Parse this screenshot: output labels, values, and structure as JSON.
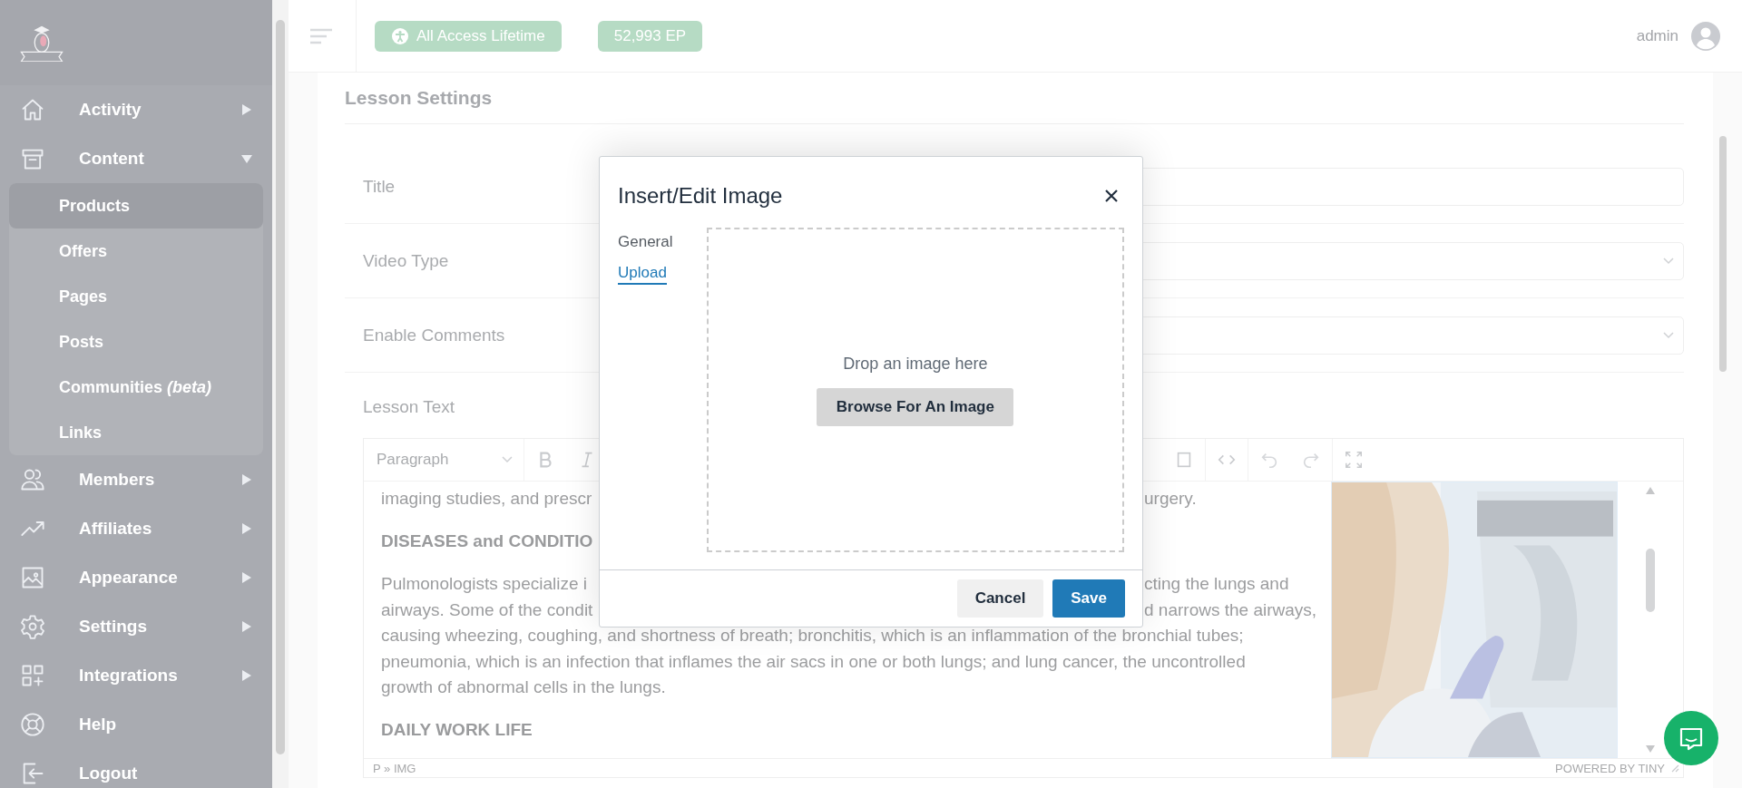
{
  "sidebar": {
    "items": [
      {
        "label": "Activity",
        "expanded": false
      },
      {
        "label": "Content",
        "expanded": true,
        "children": [
          {
            "label": "Products",
            "selected": true
          },
          {
            "label": "Offers",
            "selected": false
          },
          {
            "label": "Pages",
            "selected": false
          },
          {
            "label": "Posts",
            "selected": false
          },
          {
            "label": "Communities *(beta)*",
            "selected": false
          },
          {
            "label": "Links",
            "selected": false
          }
        ]
      },
      {
        "label": "Members",
        "expanded": false
      },
      {
        "label": "Affiliates",
        "expanded": false
      },
      {
        "label": "Appearance",
        "expanded": false
      },
      {
        "label": "Settings",
        "expanded": false
      },
      {
        "label": "Integrations",
        "expanded": false
      },
      {
        "label": "Help"
      },
      {
        "label": "Logout"
      }
    ]
  },
  "topbar": {
    "badges": [
      "All Access Lifetime",
      "52,993 EP"
    ],
    "user": "admin"
  },
  "form": {
    "title": "Lesson Settings",
    "fields": [
      {
        "label": "Title",
        "kind": "input"
      },
      {
        "label": "Video Type",
        "kind": "select"
      },
      {
        "label": "Enable Comments",
        "kind": "select"
      },
      {
        "label": "Lesson Text",
        "kind": "editor"
      }
    ]
  },
  "editor": {
    "block_format": "Paragraph",
    "lines": [
      {
        "kind": "text",
        "parts": [
          "imaging studies, and prescr",
          "urgery."
        ]
      },
      {
        "kind": "heading",
        "parts": [
          "DISEASES and CONDITIO"
        ]
      },
      {
        "kind": "text",
        "parts": [
          "Pulmonologists specialize i",
          "cting the lungs and"
        ]
      },
      {
        "kind": "text",
        "parts": [
          "airways. Some of the condit",
          "d narrows the airways,"
        ]
      },
      {
        "kind": "text",
        "parts": [
          "causing wheezing, coughing, and shortness of breath; bronchitis, which is an inflammation of the bronchial tubes;"
        ]
      },
      {
        "kind": "text",
        "parts": [
          "pneumonia, which is an infection that inflames the air sacs in one or both lungs; and lung cancer, the uncontrolled"
        ]
      },
      {
        "kind": "text",
        "parts": [
          "growth of abnormal cells in the lungs."
        ]
      },
      {
        "kind": "heading",
        "parts": [
          "DAILY WORK LIFE"
        ]
      }
    ],
    "path": "P » IMG",
    "branding": "POWERED BY TINY"
  },
  "dialog": {
    "title": "Insert/Edit Image",
    "tabs": [
      {
        "label": "General",
        "selected": false
      },
      {
        "label": "Upload",
        "selected": true
      }
    ],
    "drop_text": "Drop an image here",
    "browse": "Browse For An Image",
    "buttons": {
      "cancel": "Cancel",
      "save": "Save"
    }
  }
}
